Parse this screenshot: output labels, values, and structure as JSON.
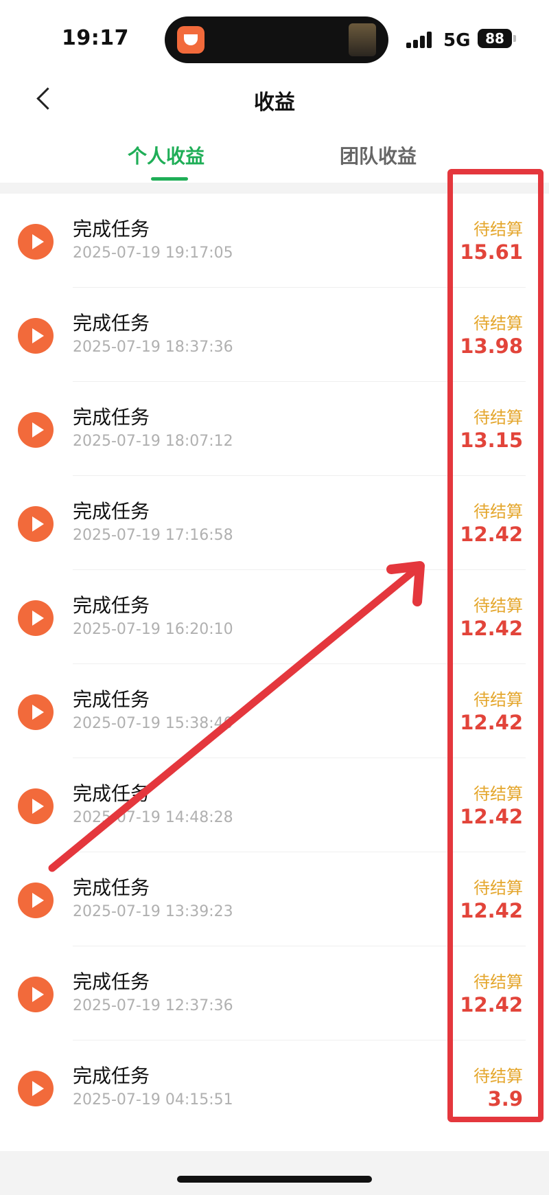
{
  "status_bar": {
    "time": "19:17",
    "network": "5G",
    "battery": "88"
  },
  "header": {
    "title": "收益"
  },
  "tabs": [
    {
      "label": "个人收益",
      "active": true
    },
    {
      "label": "团队收益",
      "active": false
    }
  ],
  "colors": {
    "accent_green": "#1fae57",
    "pending_yellow": "#e4a62c",
    "amount_red": "#e2443a",
    "icon_orange": "#f26a3b",
    "annotation_red": "#e4373d"
  },
  "records": [
    {
      "title": "完成任务",
      "time": "2025-07-19 19:17:05",
      "status": "待结算",
      "amount": "15.61"
    },
    {
      "title": "完成任务",
      "time": "2025-07-19 18:37:36",
      "status": "待结算",
      "amount": "13.98"
    },
    {
      "title": "完成任务",
      "time": "2025-07-19 18:07:12",
      "status": "待结算",
      "amount": "13.15"
    },
    {
      "title": "完成任务",
      "time": "2025-07-19 17:16:58",
      "status": "待结算",
      "amount": "12.42"
    },
    {
      "title": "完成任务",
      "time": "2025-07-19 16:20:10",
      "status": "待结算",
      "amount": "12.42"
    },
    {
      "title": "完成任务",
      "time": "2025-07-19 15:38:40",
      "status": "待结算",
      "amount": "12.42"
    },
    {
      "title": "完成任务",
      "time": "2025-07-19 14:48:28",
      "status": "待结算",
      "amount": "12.42"
    },
    {
      "title": "完成任务",
      "time": "2025-07-19 13:39:23",
      "status": "待结算",
      "amount": "12.42"
    },
    {
      "title": "完成任务",
      "time": "2025-07-19 12:37:36",
      "status": "待结算",
      "amount": "12.42"
    },
    {
      "title": "完成任务",
      "time": "2025-07-19 04:15:51",
      "status": "待结算",
      "amount": "3.9"
    }
  ]
}
